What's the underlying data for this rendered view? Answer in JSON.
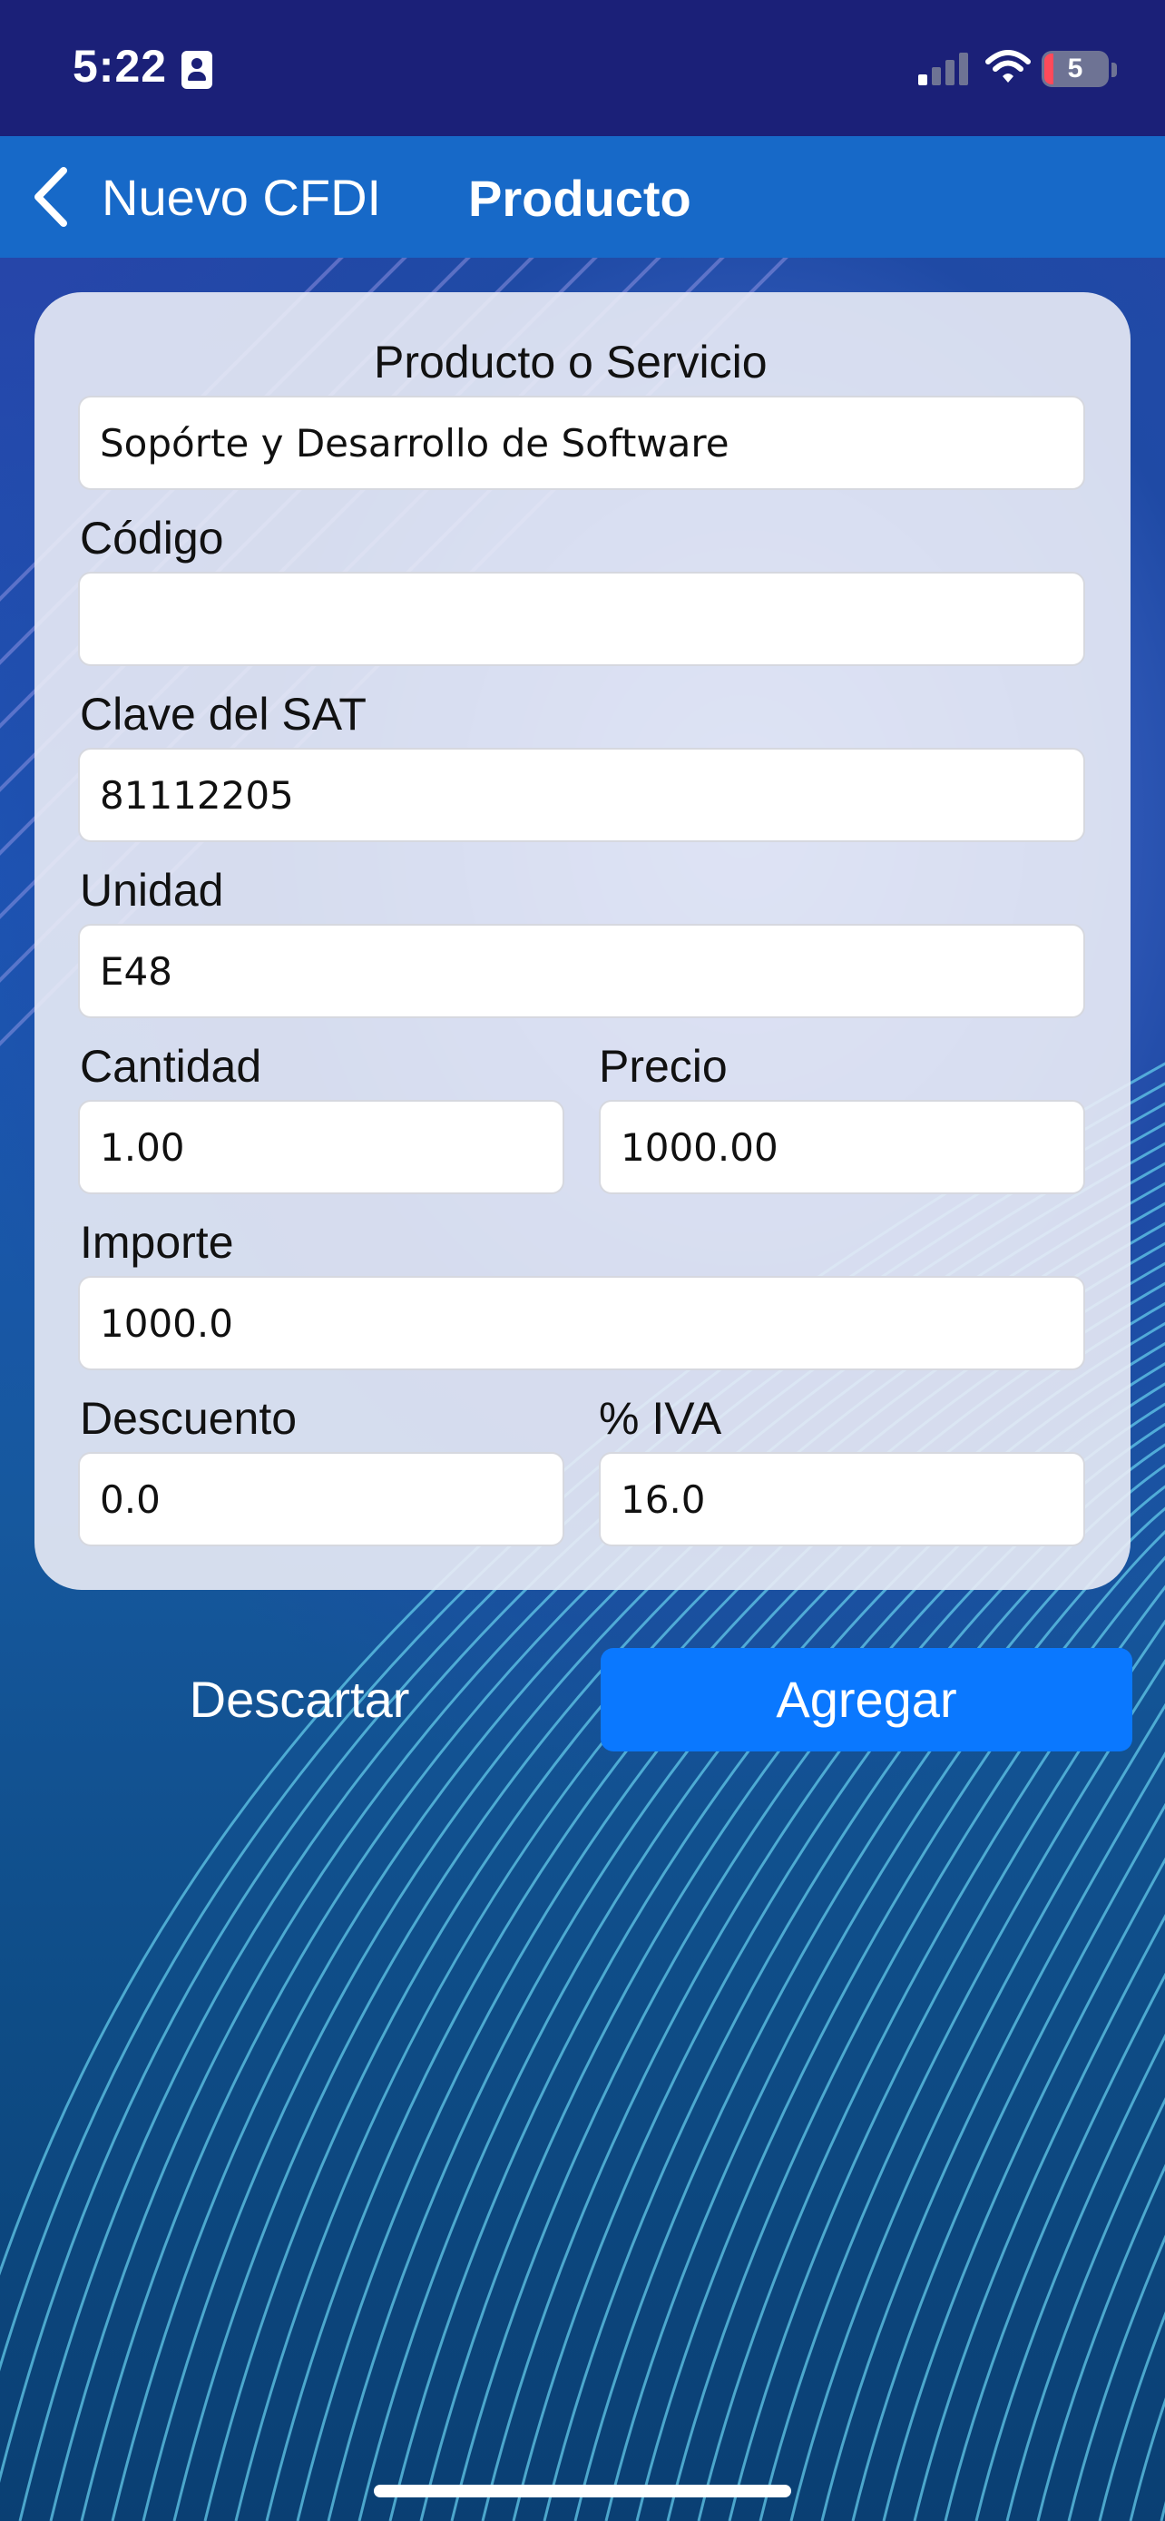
{
  "status_bar": {
    "time": "5:22",
    "battery_level": "5",
    "icons": [
      "id-card-icon",
      "signal-icon",
      "wifi-icon",
      "battery-icon"
    ]
  },
  "nav": {
    "back_label": "Nuevo CFDI",
    "title": "Producto",
    "icon": "chevron-left-icon"
  },
  "form": {
    "producto_label": "Producto o Servicio",
    "producto_value": "Sopórte y Desarrollo de Software",
    "codigo_label": "Código",
    "codigo_value": "",
    "clave_label": "Clave del SAT",
    "clave_value": "81112205",
    "unidad_label": "Unidad",
    "unidad_value": "E48",
    "cantidad_label": "Cantidad",
    "cantidad_value": "1.00",
    "precio_label": "Precio",
    "precio_value": "1000.00",
    "importe_label": "Importe",
    "importe_value": "1000.0",
    "descuento_label": "Descuento",
    "descuento_value": "0.0",
    "iva_label": "% IVA",
    "iva_value": "16.0"
  },
  "actions": {
    "discard_label": "Descartar",
    "add_label": "Agregar"
  },
  "colors": {
    "status_bar_bg": "#1b2078",
    "nav_bar_bg": "#1769c8",
    "primary_button": "#0a78ff",
    "card_bg": "#eaecf6"
  }
}
